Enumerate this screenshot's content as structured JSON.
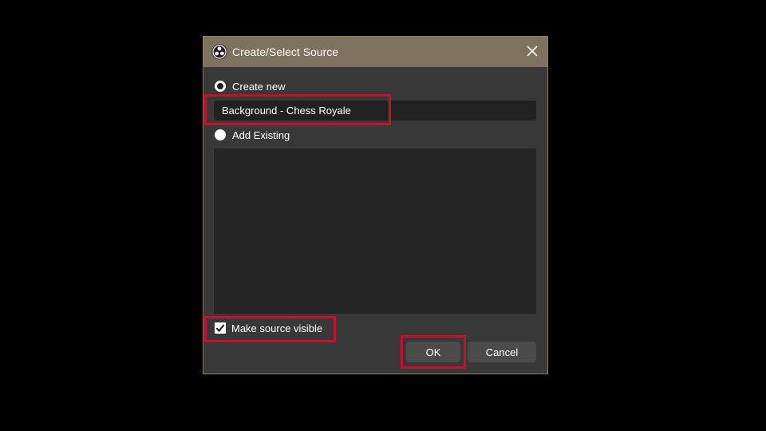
{
  "dialog": {
    "title": "Create/Select Source",
    "logo_icon": "obs-logo-icon",
    "close_icon": "close-icon"
  },
  "create_new": {
    "label": "Create new",
    "selected": true,
    "input_value": "Background - Chess Royale"
  },
  "add_existing": {
    "label": "Add Existing",
    "selected": false,
    "items": []
  },
  "visibility": {
    "label": "Make source visible",
    "checked": true
  },
  "buttons": {
    "ok_label": "OK",
    "cancel_label": "Cancel"
  },
  "colors": {
    "titlebar": "#7e725f",
    "dialog_bg": "#393838",
    "highlight": "#c8102e"
  }
}
